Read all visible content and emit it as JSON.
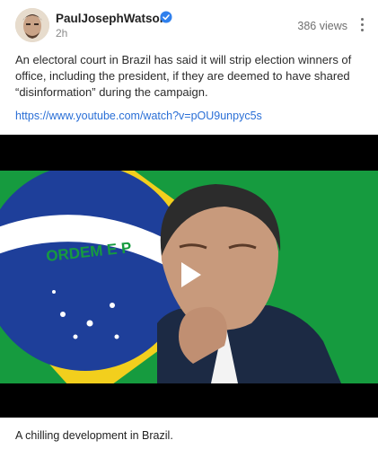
{
  "post": {
    "author": "PaulJosephWatson",
    "time": "2h",
    "views": "386 views",
    "text": "An electoral court in Brazil has said it will strip election winners of office, including the president, if they are deemed to have shared “disinformation” during the campaign.",
    "link": "https://www.youtube.com/watch?v=pOU9unpyc5s",
    "caption": "A chilling development in Brazil."
  },
  "video": {
    "banner_text": "ORDEM E P"
  },
  "colors": {
    "flag_green": "#169b3f",
    "flag_yellow": "#f2cf1d",
    "flag_blue": "#1e3f9a",
    "link": "#2a6fd6",
    "verified": "#2f80ed"
  },
  "icons": {
    "verified": "verified-badge-icon",
    "menu": "more-vertical-icon",
    "play": "play-icon"
  }
}
